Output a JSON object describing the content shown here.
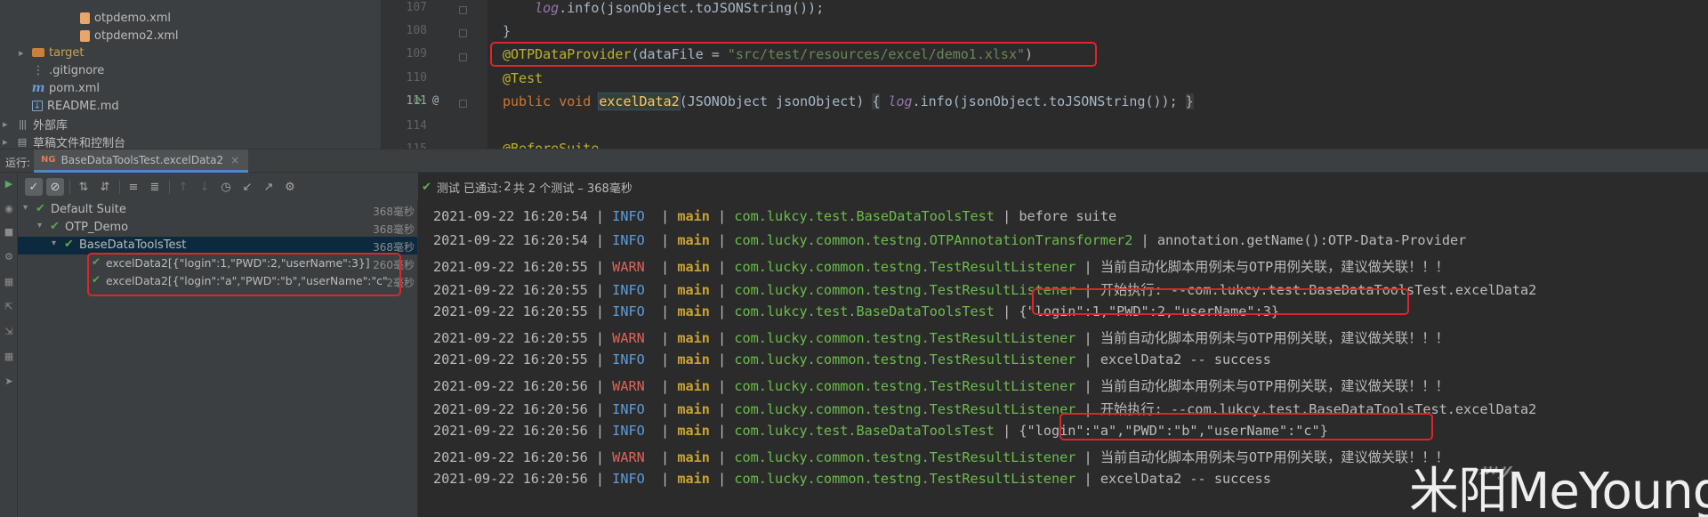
{
  "project_tree": {
    "items": [
      {
        "label": "otpdemo.xml",
        "icon": "xml-file-icon"
      },
      {
        "label": "otpdemo2.xml",
        "icon": "xml-file-icon"
      },
      {
        "label": "target",
        "icon": "folder-icon"
      },
      {
        "label": ".gitignore",
        "icon": "gitignore-icon"
      },
      {
        "label": "pom.xml",
        "icon": "maven-icon"
      },
      {
        "label": "README.md",
        "icon": "markdown-icon"
      },
      {
        "label": "外部库",
        "icon": "library-icon"
      },
      {
        "label": "草稿文件和控制台",
        "icon": "scratch-icon"
      }
    ]
  },
  "editor": {
    "line_numbers": [
      "107",
      "108",
      "109",
      "110",
      "111",
      "114",
      "115"
    ],
    "lines": {
      "l107_fld": "log",
      "l107_rest": ".info(jsonObject.toJSONString());",
      "l108": "}",
      "l109_ann": "@OTPDataProvider",
      "l109_open": "(dataFile = ",
      "l109_str": "\"src/test/resources/excel/demo1.xlsx\"",
      "l109_close": ")",
      "l110": "@Test",
      "l111_kw1": "public",
      "l111_kw2": "void",
      "l111_fn": "excelData2",
      "l111_params": "(JSONObject jsonObject) ",
      "l111_brace1": "{",
      "l111_fld": "log",
      "l111_body": ".info(jsonObject.toJSONString()); ",
      "l111_brace2": "}",
      "l115": "@BeforeSuite"
    }
  },
  "run_window": {
    "label": "运行:",
    "tab_title": "BaseDataToolsTest.excelData2",
    "close_glyph": "×"
  },
  "status": {
    "prefix": "测试 已通过:",
    "passed": "2",
    "rest": "共 2 个测试 – 368毫秒"
  },
  "test_tree": {
    "rows": [
      {
        "name": "Default Suite",
        "time": "368毫秒"
      },
      {
        "name": "OTP_Demo",
        "time": "368毫秒"
      },
      {
        "name": "BaseDataToolsTest",
        "time": "368毫秒"
      },
      {
        "name": "excelData2[{\"login\":1,\"PWD\":2,\"userName\":3}]",
        "time": "260毫秒"
      },
      {
        "name": "excelData2[{\"login\":\"a\",\"PWD\":\"b\",\"userName\":\"c\"",
        "time": "2毫秒"
      }
    ]
  },
  "console": {
    "lines": [
      {
        "ts": "2021-09-22 16:20:54",
        "level": "INFO",
        "thread": "main",
        "cls": "com.lukcy.test.BaseDataToolsTest",
        "msg": "before suite"
      },
      {
        "ts": "2021-09-22 16:20:54",
        "level": "INFO",
        "thread": "main",
        "cls": "com.lucky.common.testng.OTPAnnotationTransformer2",
        "msg": "annotation.getName():OTP-Data-Provider"
      },
      {
        "ts": "2021-09-22 16:20:55",
        "level": "WARN",
        "thread": "main",
        "cls": "com.lucky.common.testng.TestResultListener",
        "msg": "当前自动化脚本用例未与OTP用例关联，建议做关联！！！"
      },
      {
        "ts": "2021-09-22 16:20:55",
        "level": "INFO",
        "thread": "main",
        "cls": "com.lucky.common.testng.TestResultListener",
        "msg": "开始执行: --com.lukcy.test.BaseDataToolsTest.excelData2"
      },
      {
        "ts": "2021-09-22 16:20:55",
        "level": "INFO",
        "thread": "main",
        "cls": "com.lukcy.test.BaseDataToolsTest",
        "msg": "{\"login\":1,\"PWD\":2,\"userName\":3}"
      },
      {
        "ts": "2021-09-22 16:20:55",
        "level": "WARN",
        "thread": "main",
        "cls": "com.lucky.common.testng.TestResultListener",
        "msg": "当前自动化脚本用例未与OTP用例关联，建议做关联！！！"
      },
      {
        "ts": "2021-09-22 16:20:55",
        "level": "INFO",
        "thread": "main",
        "cls": "com.lucky.common.testng.TestResultListener",
        "msg": "excelData2 -- success"
      },
      {
        "ts": "2021-09-22 16:20:56",
        "level": "WARN",
        "thread": "main",
        "cls": "com.lucky.common.testng.TestResultListener",
        "msg": "当前自动化脚本用例未与OTP用例关联，建议做关联！！！"
      },
      {
        "ts": "2021-09-22 16:20:56",
        "level": "INFO",
        "thread": "main",
        "cls": "com.lucky.common.testng.TestResultListener",
        "msg": "开始执行: --com.lukcy.test.BaseDataToolsTest.excelData2"
      },
      {
        "ts": "2021-09-22 16:20:56",
        "level": "INFO",
        "thread": "main",
        "cls": "com.lukcy.test.BaseDataToolsTest",
        "msg": "{\"login\":\"a\",\"PWD\":\"b\",\"userName\":\"c\"}"
      },
      {
        "ts": "2021-09-22 16:20:56",
        "level": "WARN",
        "thread": "main",
        "cls": "com.lucky.common.testng.TestResultListener",
        "msg": "当前自动化脚本用例未与OTP用例关联，建议做关联！！！"
      },
      {
        "ts": "2021-09-22 16:20:56",
        "level": "INFO",
        "thread": "main",
        "cls": "com.lucky.common.testng.TestResultListener",
        "msg": "excelData2 -- success"
      }
    ]
  },
  "watermark": "米阳MeYoung",
  "colors": {
    "highlight_box": "#e0242a",
    "info": "#5d9ddb",
    "warn": "#e0635a",
    "thread": "#c9a335",
    "class": "#6bbd4a",
    "pass": "#57a64a"
  }
}
